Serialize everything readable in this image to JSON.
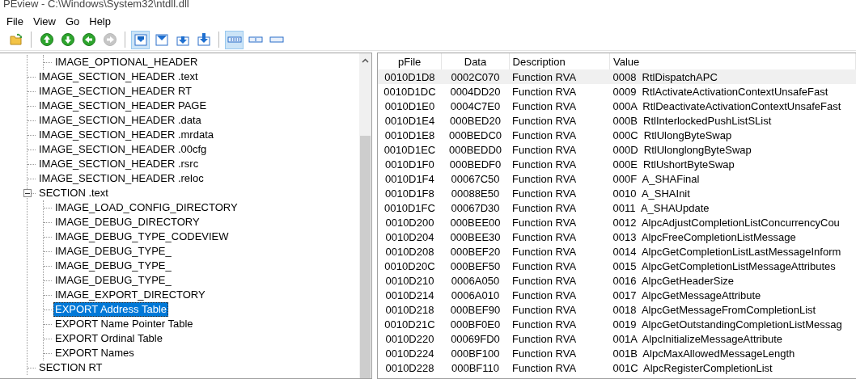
{
  "window": {
    "title": "PEview - C:\\Windows\\System32\\ntdll.dll"
  },
  "menu": [
    "File",
    "View",
    "Go",
    "Help"
  ],
  "toolbar": [
    {
      "kind": "open",
      "selected": false,
      "disabled": false
    },
    {
      "kind": "up",
      "selected": false,
      "disabled": false
    },
    {
      "kind": "down",
      "selected": false,
      "disabled": false
    },
    {
      "kind": "back",
      "selected": false,
      "disabled": false
    },
    {
      "kind": "forward",
      "selected": false,
      "disabled": true
    },
    {
      "kind": "view1",
      "selected": true,
      "disabled": false
    },
    {
      "kind": "view2",
      "selected": false,
      "disabled": false
    },
    {
      "kind": "view3",
      "selected": false,
      "disabled": false
    },
    {
      "kind": "view4",
      "selected": false,
      "disabled": false
    },
    {
      "kind": "addr1",
      "selected": true,
      "disabled": false
    },
    {
      "kind": "addr2",
      "selected": false,
      "disabled": false
    },
    {
      "kind": "addr3",
      "selected": false,
      "disabled": false
    }
  ],
  "tree": {
    "items": [
      {
        "children": [
          {
            "label": "IMAGE_OPTIONAL_HEADER",
            "selected": false
          }
        ]
      },
      {
        "label": "IMAGE_SECTION_HEADER .text",
        "selected": false
      },
      {
        "label": "IMAGE_SECTION_HEADER RT",
        "selected": false
      },
      {
        "label": "IMAGE_SECTION_HEADER PAGE",
        "selected": false
      },
      {
        "label": "IMAGE_SECTION_HEADER .data",
        "selected": false
      },
      {
        "label": "IMAGE_SECTION_HEADER .mrdata",
        "selected": false
      },
      {
        "label": "IMAGE_SECTION_HEADER .00cfg",
        "selected": false
      },
      {
        "label": "IMAGE_SECTION_HEADER .rsrc",
        "selected": false
      },
      {
        "label": "IMAGE_SECTION_HEADER .reloc",
        "selected": false
      },
      {
        "label": "SECTION .text",
        "selected": false,
        "expanded": true,
        "children": [
          {
            "label": "IMAGE_LOAD_CONFIG_DIRECTORY",
            "selected": false
          },
          {
            "label": "IMAGE_DEBUG_DIRECTORY",
            "selected": false
          },
          {
            "label": "IMAGE_DEBUG_TYPE_CODEVIEW",
            "selected": false
          },
          {
            "label": "IMAGE_DEBUG_TYPE_",
            "selected": false
          },
          {
            "label": "IMAGE_DEBUG_TYPE_",
            "selected": false
          },
          {
            "label": "IMAGE_DEBUG_TYPE_",
            "selected": false
          },
          {
            "label": "IMAGE_EXPORT_DIRECTORY",
            "selected": false
          },
          {
            "label": "EXPORT Address Table",
            "selected": true
          },
          {
            "label": "EXPORT Name Pointer Table",
            "selected": false
          },
          {
            "label": "EXPORT Ordinal Table",
            "selected": false
          },
          {
            "label": "EXPORT Names",
            "selected": false
          }
        ]
      },
      {
        "label": "SECTION RT",
        "selected": false
      }
    ]
  },
  "table": {
    "columns": [
      "pFile",
      "Data",
      "Description",
      "Value"
    ],
    "rows": [
      {
        "cells": [
          "0010D1D8",
          "0002C070",
          "Function RVA",
          "0008  RtlDispatchAPC"
        ],
        "selected": true
      },
      {
        "cells": [
          "0010D1DC",
          "0004DD20",
          "Function RVA",
          "0009  RtlActivateActivationContextUnsafeFast"
        ],
        "selected": false
      },
      {
        "cells": [
          "0010D1E0",
          "0004C7E0",
          "Function RVA",
          "000A  RtlDeactivateActivationContextUnsafeFast"
        ],
        "selected": false
      },
      {
        "cells": [
          "0010D1E4",
          "000BED20",
          "Function RVA",
          "000B  RtlInterlockedPushListSList"
        ],
        "selected": false
      },
      {
        "cells": [
          "0010D1E8",
          "000BEDC0",
          "Function RVA",
          "000C  RtlUlongByteSwap"
        ],
        "selected": false
      },
      {
        "cells": [
          "0010D1EC",
          "000BEDD0",
          "Function RVA",
          "000D  RtlUlonglongByteSwap"
        ],
        "selected": false
      },
      {
        "cells": [
          "0010D1F0",
          "000BEDF0",
          "Function RVA",
          "000E  RtlUshortByteSwap"
        ],
        "selected": false
      },
      {
        "cells": [
          "0010D1F4",
          "00067C50",
          "Function RVA",
          "000F  A_SHAFinal"
        ],
        "selected": false
      },
      {
        "cells": [
          "0010D1F8",
          "00088E50",
          "Function RVA",
          "0010  A_SHAInit"
        ],
        "selected": false
      },
      {
        "cells": [
          "0010D1FC",
          "00067D30",
          "Function RVA",
          "0011  A_SHAUpdate"
        ],
        "selected": false
      },
      {
        "cells": [
          "0010D200",
          "000BEE00",
          "Function RVA",
          "0012  AlpcAdjustCompletionListConcurrencyCou"
        ],
        "selected": false
      },
      {
        "cells": [
          "0010D204",
          "000BEE30",
          "Function RVA",
          "0013  AlpcFreeCompletionListMessage"
        ],
        "selected": false
      },
      {
        "cells": [
          "0010D208",
          "000BEF20",
          "Function RVA",
          "0014  AlpcGetCompletionListLastMessageInform"
        ],
        "selected": false
      },
      {
        "cells": [
          "0010D20C",
          "000BEF50",
          "Function RVA",
          "0015  AlpcGetCompletionListMessageAttributes"
        ],
        "selected": false
      },
      {
        "cells": [
          "0010D210",
          "0006A050",
          "Function RVA",
          "0016  AlpcGetHeaderSize"
        ],
        "selected": false
      },
      {
        "cells": [
          "0010D214",
          "0006A010",
          "Function RVA",
          "0017  AlpcGetMessageAttribute"
        ],
        "selected": false
      },
      {
        "cells": [
          "0010D218",
          "000BEF90",
          "Function RVA",
          "0018  AlpcGetMessageFromCompletionList"
        ],
        "selected": false
      },
      {
        "cells": [
          "0010D21C",
          "000BF0E0",
          "Function RVA",
          "0019  AlpcGetOutstandingCompletionListMessag"
        ],
        "selected": false
      },
      {
        "cells": [
          "0010D220",
          "00069FD0",
          "Function RVA",
          "001A  AlpcInitializeMessageAttribute"
        ],
        "selected": false
      },
      {
        "cells": [
          "0010D224",
          "000BF100",
          "Function RVA",
          "001B  AlpcMaxAllowedMessageLength"
        ],
        "selected": false
      },
      {
        "cells": [
          "0010D228",
          "000BF110",
          "Function RVA",
          "001C  AlpcRegisterCompletionList"
        ],
        "selected": false
      }
    ]
  }
}
